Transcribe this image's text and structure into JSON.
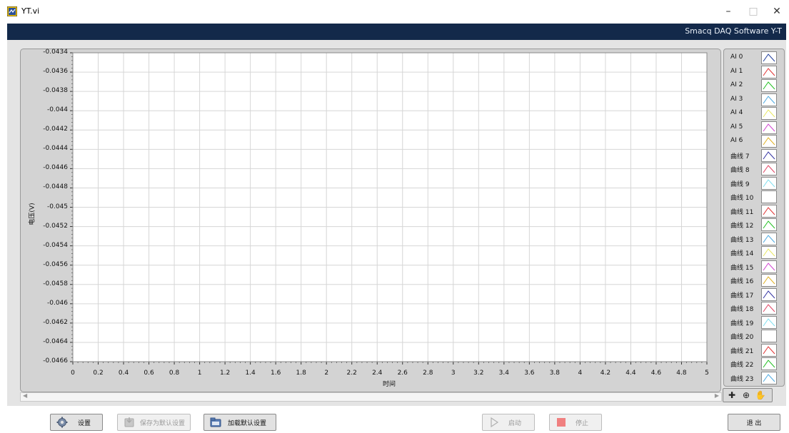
{
  "window": {
    "title": "YT.vi",
    "minimize": "–",
    "maximize": "□",
    "close": "✕"
  },
  "banner": {
    "text": "Smacq DAQ Software Y-T"
  },
  "graph": {
    "y_axis_label": "电压(V)",
    "x_axis_label": "时间",
    "y_ticks": [
      "-0.0434",
      "-0.0436",
      "-0.0438",
      "-0.044",
      "-0.0442",
      "-0.0444",
      "-0.0446",
      "-0.0448",
      "-0.045",
      "-0.0452",
      "-0.0454",
      "-0.0456",
      "-0.0458",
      "-0.046",
      "-0.0462",
      "-0.0464",
      "-0.0466"
    ],
    "x_ticks": [
      "0",
      "0.2",
      "0.4",
      "0.6",
      "0.8",
      "1",
      "1.2",
      "1.4",
      "1.6",
      "1.8",
      "2",
      "2.2",
      "2.4",
      "2.6",
      "2.8",
      "3",
      "3.2",
      "3.4",
      "3.6",
      "3.8",
      "4",
      "4.2",
      "4.4",
      "4.6",
      "4.8",
      "5"
    ]
  },
  "chart_data": {
    "type": "line",
    "xlabel": "时间",
    "ylabel": "电压(V)",
    "xlim": [
      0,
      5
    ],
    "ylim": [
      -0.0466,
      -0.0434
    ],
    "grid": true,
    "legend_placement": "right",
    "series": []
  },
  "legend": {
    "items": [
      {
        "label": "AI 0",
        "color": "#1c3a9a"
      },
      {
        "label": "AI 1",
        "color": "#e03030"
      },
      {
        "label": "AI 2",
        "color": "#20c020"
      },
      {
        "label": "AI 3",
        "color": "#4aa8e0"
      },
      {
        "label": "AI 4",
        "color": "#e8e860"
      },
      {
        "label": "AI 5",
        "color": "#d040d0"
      },
      {
        "label": "AI 6",
        "color": "#e0b020"
      },
      {
        "label": "曲线 7",
        "color": "#3030a0"
      },
      {
        "label": "曲线 8",
        "color": "#e04060"
      },
      {
        "label": "曲线 9",
        "color": "#80e0f0"
      },
      {
        "label": "曲线 10",
        "color": "#ffffff"
      },
      {
        "label": "曲线 11",
        "color": "#e03030"
      },
      {
        "label": "曲线 12",
        "color": "#20c020"
      },
      {
        "label": "曲线 13",
        "color": "#4aa8e0"
      },
      {
        "label": "曲线 14",
        "color": "#e8e860"
      },
      {
        "label": "曲线 15",
        "color": "#d040d0"
      },
      {
        "label": "曲线 16",
        "color": "#e0b020"
      },
      {
        "label": "曲线 17",
        "color": "#3030a0"
      },
      {
        "label": "曲线 18",
        "color": "#e04060"
      },
      {
        "label": "曲线 19",
        "color": "#80e0f0"
      },
      {
        "label": "曲线 20",
        "color": "#ffffff"
      },
      {
        "label": "曲线 21",
        "color": "#e03030"
      },
      {
        "label": "曲线 22",
        "color": "#20c020"
      },
      {
        "label": "曲线 23",
        "color": "#4aa8e0"
      }
    ]
  },
  "buttons": {
    "settings": "设置",
    "save_default": "保存为默认设置",
    "load_default": "加载默认设置",
    "start": "启动",
    "stop": "停止",
    "exit": "退 出"
  },
  "icons": {
    "settings": "gear-icon",
    "save_default": "save-icon",
    "load_default": "folder-icon",
    "start": "play-icon",
    "stop": "stop-icon"
  },
  "colors": {
    "banner": "#13294a",
    "plot_bg": "#ffffff",
    "panel_bg": "#d3d3d3"
  }
}
